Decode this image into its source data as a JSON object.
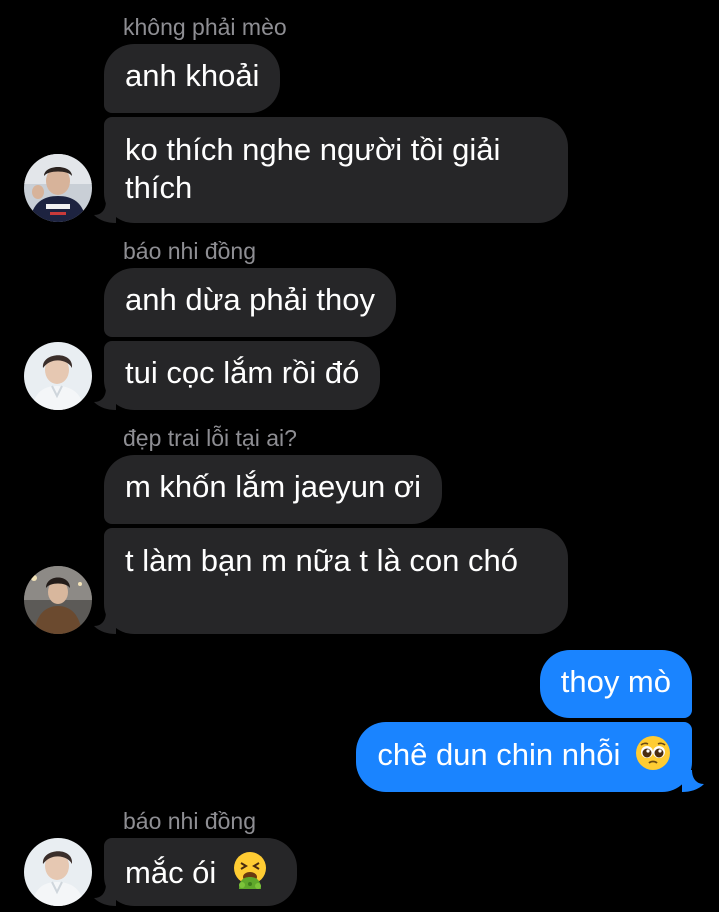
{
  "conversation": {
    "groups": [
      {
        "sender": "không phải mèo",
        "messages": [
          "anh khoải",
          "ko thích nghe người tồi giải thích"
        ]
      },
      {
        "sender": "báo nhi đồng",
        "messages": [
          "anh dừa phải thoy",
          "tui cọc lắm rồi đó"
        ]
      },
      {
        "sender": "đẹp trai lỗi tại ai?",
        "messages": [
          "m khốn lắm jaeyun ơi",
          "t làm bạn m nữa t là con chó"
        ]
      },
      {
        "sender": "",
        "outgoing": true,
        "messages": [
          "thoy mò",
          "chê dun chin nhỗi"
        ]
      },
      {
        "sender": "báo nhi đồng",
        "messages": [
          "mắc ói"
        ]
      }
    ]
  },
  "emojis": {
    "pleading": "pleading-face",
    "vomiting": "face-vomiting"
  },
  "colors": {
    "background": "#000000",
    "incoming_bubble": "#262628",
    "outgoing_bubble": "#1a84ff",
    "sender_name": "#8e8e93"
  }
}
